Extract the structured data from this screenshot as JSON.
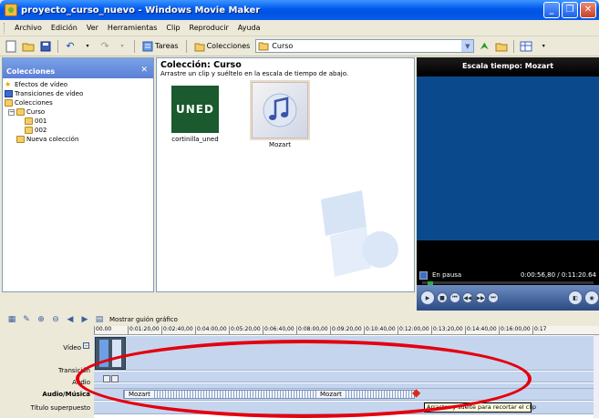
{
  "window": {
    "title": "proyecto_curso_nuevo - Windows Movie Maker"
  },
  "menu": [
    "Archivo",
    "Edición",
    "Ver",
    "Herramientas",
    "Clip",
    "Reproducir",
    "Ayuda"
  ],
  "toolbar": {
    "tasks_label": "Tareas",
    "collections_label": "Colecciones",
    "collection_selected": "Curso"
  },
  "left_panel": {
    "title": "Colecciones",
    "tree": [
      {
        "label": "Efectos de vídeo",
        "indent": 0,
        "icon": "star-icon"
      },
      {
        "label": "Transiciones de vídeo",
        "indent": 0,
        "icon": "transition-icon"
      },
      {
        "label": "Colecciones",
        "indent": 0,
        "icon": "folder-icon"
      },
      {
        "label": "Curso",
        "indent": 1,
        "icon": "folder-icon"
      },
      {
        "label": "001",
        "indent": 2,
        "icon": "folder-icon"
      },
      {
        "label": "002",
        "indent": 2,
        "icon": "folder-icon"
      },
      {
        "label": "Nueva colección",
        "indent": 1,
        "icon": "folder-icon"
      }
    ]
  },
  "collection": {
    "title": "Colección: Curso",
    "subtitle": "Arrastre un clip y suéltelo en la escala de tiempo de abajo.",
    "clips": [
      {
        "name": "cortinilla_uned",
        "thumb_text": "UNED"
      },
      {
        "name": "Mozart"
      }
    ]
  },
  "preview": {
    "title": "Escala tiempo: Mozart",
    "status": "En pausa",
    "time": "0:00:56,80 / 0:11:20.64"
  },
  "storyboard": {
    "show_label": "Mostrar guión gráfico"
  },
  "timeline": {
    "ruler": [
      "00.00",
      "0:01:20,00",
      "0:02:40,00",
      "0:04:00,00",
      "0:05:20,00",
      "0:06:40,00",
      "0:08:00,00",
      "0:09:20,00",
      "0:10:40,00",
      "0:12:00,00",
      "0:13:20,00",
      "0:14:40,00",
      "0:16:00,00",
      "0:17"
    ],
    "tracks": {
      "video": "Vídeo",
      "transition": "Transición",
      "audio": "Audio",
      "audio_music": "Audio/Música",
      "title_overlay": "Título superpuesto"
    },
    "audio_clip": "Mozart",
    "audio_clip_mid": "Mozart",
    "tooltip": "Arrastre y suelte para recortar el clip"
  },
  "colors": {
    "accent": "#0054e3",
    "preview_screen": "#0a4a8c",
    "highlight": "#e3000f"
  }
}
